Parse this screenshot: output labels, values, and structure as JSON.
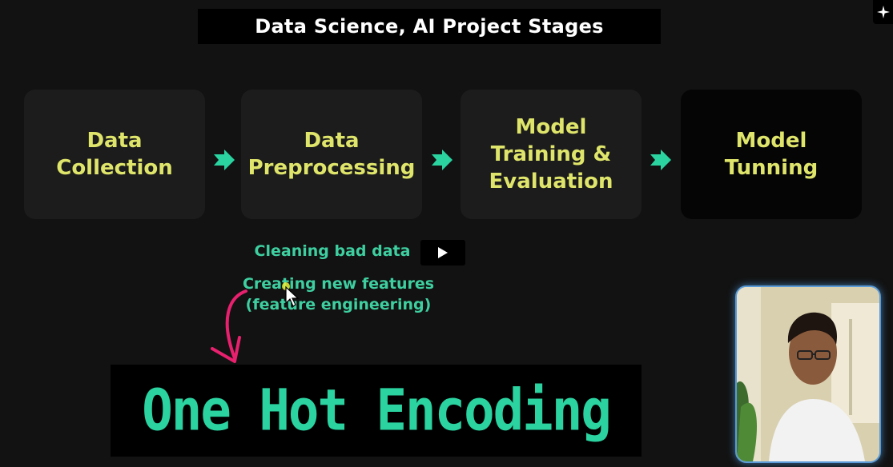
{
  "title": "Data Science, AI Project Stages",
  "stages": [
    {
      "label": "Data\nCollection"
    },
    {
      "label": "Data\nPreprocessing"
    },
    {
      "label": "Model\nTraining &\nEvaluation"
    },
    {
      "label": "Model\nTunning"
    }
  ],
  "preprocessing_notes": {
    "cleaning": "Cleaning bad data",
    "creating_line1": "Creating new features",
    "creating_line2": "(feature engineering)"
  },
  "highlight": "One Hot Encoding",
  "icons": {
    "stage_arrow": "chevron-right-icon",
    "play": "play-icon",
    "sparkle": "sparkle-icon",
    "annotation": "curved-arrow-icon",
    "cursor": "mouse-cursor-icon"
  },
  "colors": {
    "background": "#121212",
    "stage_text": "#dfe56a",
    "accent_teal": "#2ad3a0",
    "annotation_pink": "#e8206e"
  }
}
